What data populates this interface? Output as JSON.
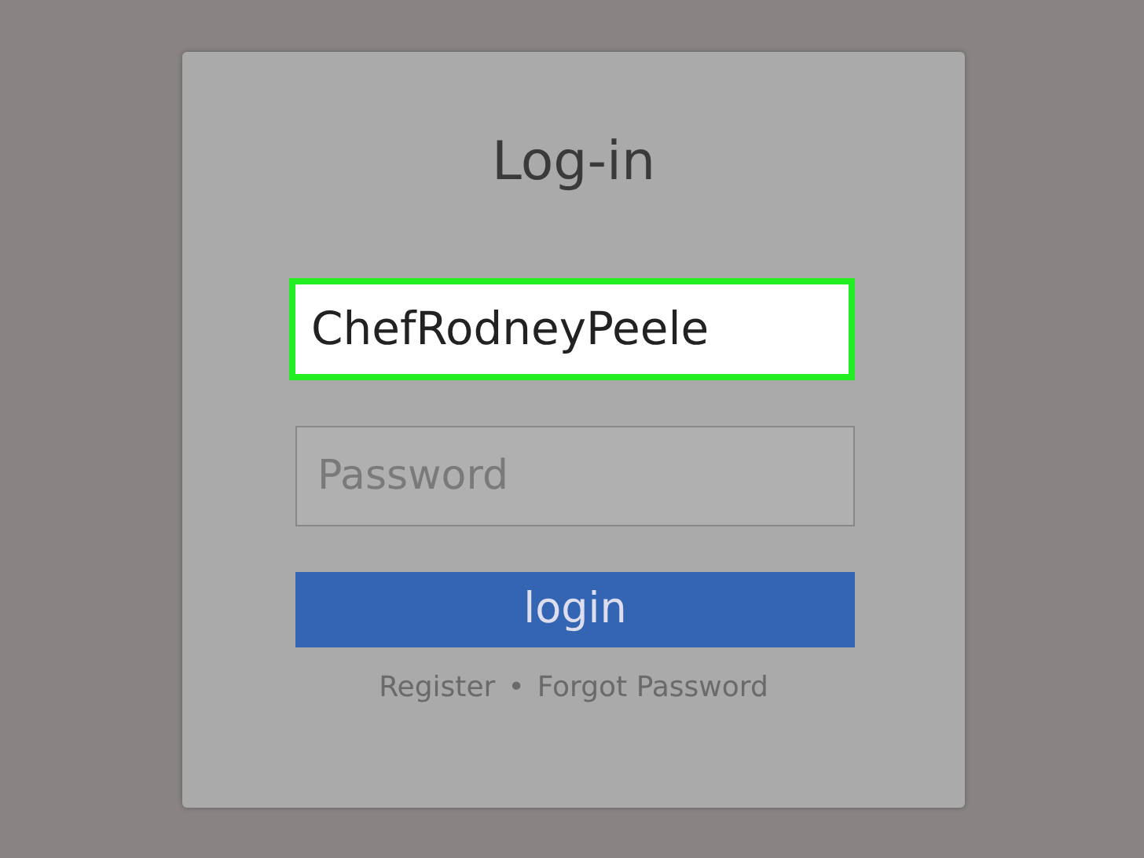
{
  "title": "Log-in",
  "username": {
    "value": "ChefRodneyPeele",
    "highlighted": true
  },
  "password": {
    "placeholder": "Password"
  },
  "login_button": "login",
  "links": [
    "Register",
    "Forgot Password"
  ],
  "link_separator": "•"
}
